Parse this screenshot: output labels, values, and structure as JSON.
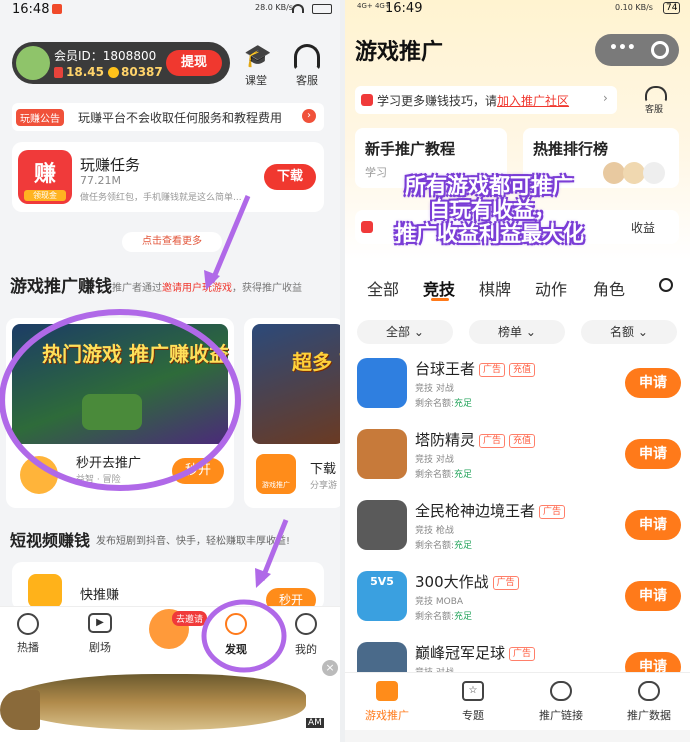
{
  "left": {
    "status_time": "16:48",
    "status_right": "28.0 KB/s",
    "battery": "",
    "profile": {
      "member_id": "会员ID：1808800",
      "balance": "18.45",
      "coins": "80387",
      "withdraw": "提现"
    },
    "top_icons": [
      {
        "label": "课堂",
        "icon": "graduation-cap-icon"
      },
      {
        "label": "客服",
        "icon": "headset-icon"
      }
    ],
    "notice": {
      "badge": "玩赚公告",
      "text": "玩赚平台不会收取任何服务和教程费用"
    },
    "task": {
      "icon_text": "赚",
      "icon_sub": "领现金",
      "name": "玩赚任务",
      "size": "77.21M",
      "desc": "做任务领红包，手机赚钱就是这么简单...",
      "button": "下载"
    },
    "more": "点击查看更多",
    "promo_section": {
      "title": "游戏推广赚钱",
      "desc_prefix": "推广者通过",
      "desc_link": "邀请用户玩游戏",
      "desc_suffix": "，获得推广收益"
    },
    "promo_cards": [
      {
        "banner": "热门游戏 推广赚收益",
        "name": "秒开去推广",
        "sub": "益智 · 冒险",
        "button": "秒开"
      },
      {
        "banner": "超多 下载推",
        "name": "下载",
        "sub": "分享游",
        "icon_label": "游戏推广"
      }
    ],
    "short_video": {
      "title": "短视频赚钱",
      "desc": "发布短剧到抖音、快手，轻松赚取丰厚收益!"
    },
    "kuai": {
      "name": "快推赚",
      "button": "秒开"
    },
    "bottom_nav": [
      {
        "label": "热播",
        "icon": "fire-icon"
      },
      {
        "label": "剧场",
        "icon": "play-icon"
      },
      {
        "label": "去邀请",
        "icon": "invite-icon"
      },
      {
        "label": "发现",
        "icon": "planet-icon"
      },
      {
        "label": "我的",
        "icon": "user-icon"
      }
    ],
    "ad_mark": "AM"
  },
  "right": {
    "status_time": "16:49",
    "status_net": "4G+ 4G+",
    "status_right": "0.10 KB/s",
    "battery": "74",
    "page_title": "游戏推广",
    "tip": {
      "text": "学习更多赚钱技巧，请",
      "link": "加入推广社区"
    },
    "service": "客服",
    "cards": [
      {
        "title": "新手推广教程",
        "sub": "学习"
      },
      {
        "title": "热推排行榜",
        "sub": ""
      }
    ],
    "notice_tail": "收益",
    "overlay": [
      "所有游戏都可推广",
      "自玩有收益，",
      "推广收益利益最大化"
    ],
    "tabs": [
      "全部",
      "竞技",
      "棋牌",
      "动作",
      "角色"
    ],
    "active_tab": 1,
    "filters": [
      "全部",
      "榜单",
      "名额"
    ],
    "games": [
      {
        "name": "台球王者",
        "tags": [
          "广告",
          "充值"
        ],
        "sub": "竞技  对战",
        "quota_label": "剩余名额:",
        "quota": "充足",
        "button": "申请",
        "color": "#2f7fe0"
      },
      {
        "name": "塔防精灵",
        "tags": [
          "广告",
          "充值"
        ],
        "sub": "竞技  对战",
        "quota_label": "剩余名额:",
        "quota": "充足",
        "button": "申请",
        "color": "#c77a3a"
      },
      {
        "name": "全民枪神边境王者",
        "tags": [
          "广告"
        ],
        "sub": "竞技  枪战",
        "quota_label": "剩余名额:",
        "quota": "充足",
        "button": "申请",
        "color": "#5a5a5a"
      },
      {
        "name": "300大作战",
        "tags": [
          "广告"
        ],
        "sub": "竞技  MOBA",
        "quota_label": "剩余名额:",
        "quota": "充足",
        "button": "申请",
        "color": "#3aa0e0",
        "icon_text": "5V5"
      },
      {
        "name": "巅峰冠军足球",
        "tags": [
          "广告"
        ],
        "sub": "竞技  对战",
        "quota_label": "",
        "quota": "",
        "button": "申请",
        "color": "#4a6a8a"
      }
    ],
    "bottom_nav": [
      {
        "label": "游戏推广",
        "icon": "house-icon"
      },
      {
        "label": "专题",
        "icon": "star-icon"
      },
      {
        "label": "推广链接",
        "icon": "link-icon"
      },
      {
        "label": "推广数据",
        "icon": "chart-icon"
      }
    ]
  }
}
